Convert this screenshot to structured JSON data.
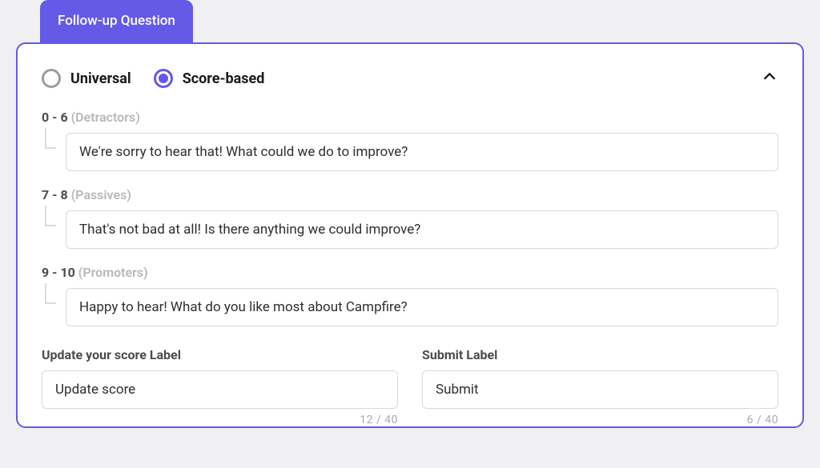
{
  "tab": {
    "label": "Follow-up Question"
  },
  "radios": {
    "universal": {
      "label": "Universal",
      "selected": false
    },
    "score_based": {
      "label": "Score-based",
      "selected": true
    }
  },
  "groups": [
    {
      "range": "0 - 6",
      "name": "(Detractors)",
      "value": "We're sorry to hear that! What could we do to improve?"
    },
    {
      "range": "7 - 8",
      "name": "(Passives)",
      "value": "That's not bad at all! Is there anything we could improve?"
    },
    {
      "range": "9 - 10",
      "name": "(Promoters)",
      "value": "Happy to hear! What do you like most about Campfire?"
    }
  ],
  "update_score": {
    "label": "Update your score Label",
    "value": "Update score",
    "count": "12 / 40"
  },
  "submit": {
    "label": "Submit Label",
    "value": "Submit",
    "count": "6 / 40"
  }
}
